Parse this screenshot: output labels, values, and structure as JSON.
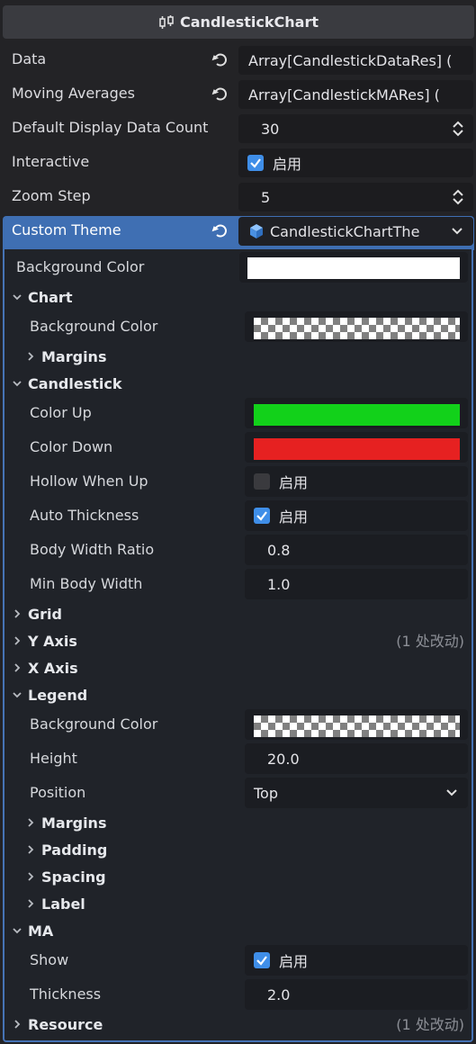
{
  "header": {
    "title": "CandlestickChart",
    "icon": "candlestick-node-icon"
  },
  "properties": {
    "data": {
      "label": "Data",
      "value": "Array[CandlestickDataRes] ("
    },
    "moving_averages": {
      "label": "Moving Averages",
      "value": "Array[CandlestickMARes] ("
    },
    "default_display_count": {
      "label": "Default Display Data Count",
      "value": "30"
    },
    "interactive": {
      "label": "Interactive",
      "checked": true,
      "check_label": "启用"
    },
    "zoom_step": {
      "label": "Zoom Step",
      "value": "5"
    },
    "custom_theme": {
      "label": "Custom Theme",
      "value": "CandlestickChartThe"
    }
  },
  "theme": {
    "background_color": {
      "label": "Background Color",
      "color": "#ffffff"
    },
    "chart": {
      "title": "Chart",
      "background_color": {
        "label": "Background Color",
        "color": "transparent"
      },
      "margins": {
        "title": "Margins"
      }
    },
    "candlestick": {
      "title": "Candlestick",
      "color_up": {
        "label": "Color Up",
        "color": "#12d11a"
      },
      "color_down": {
        "label": "Color Down",
        "color": "#e62121"
      },
      "hollow_when_up": {
        "label": "Hollow When Up",
        "checked": false,
        "check_label": "启用"
      },
      "auto_thickness": {
        "label": "Auto Thickness",
        "checked": true,
        "check_label": "启用"
      },
      "body_width_ratio": {
        "label": "Body Width Ratio",
        "value": "0.8"
      },
      "min_body_width": {
        "label": "Min Body Width",
        "value": "1.0"
      }
    },
    "grid": {
      "title": "Grid"
    },
    "y_axis": {
      "title": "Y Axis",
      "note": "(1 处改动)"
    },
    "x_axis": {
      "title": "X Axis"
    },
    "legend": {
      "title": "Legend",
      "background_color": {
        "label": "Background Color",
        "color": "transparent"
      },
      "height": {
        "label": "Height",
        "value": "20.0"
      },
      "position": {
        "label": "Position",
        "value": "Top"
      },
      "margins": {
        "title": "Margins"
      },
      "padding": {
        "title": "Padding"
      },
      "spacing": {
        "title": "Spacing"
      },
      "label": {
        "title": "Label"
      }
    },
    "ma": {
      "title": "MA",
      "show": {
        "label": "Show",
        "checked": true,
        "check_label": "启用"
      },
      "thickness": {
        "label": "Thickness",
        "value": "2.0"
      }
    },
    "resource": {
      "title": "Resource",
      "note": "(1 处改动)"
    }
  },
  "colors": {
    "accent": "#3f8ee8",
    "selected_row": "#3f6fb3",
    "panel_border": "#4673b5"
  }
}
